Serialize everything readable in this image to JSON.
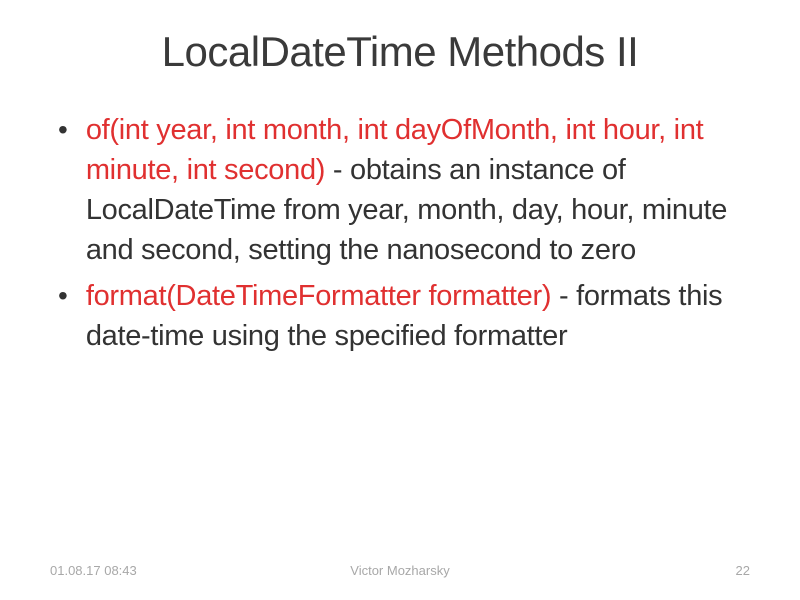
{
  "title": "LocalDateTime Methods II",
  "bullets": [
    {
      "red": "of(int year, int month, int dayOfMonth,  int hour, int minute, int second)",
      "black": " - obtains an instance of LocalDateTime from year, month, day, hour, minute and second, setting the nanosecond to zero"
    },
    {
      "red": "format(DateTimeFormatter  formatter)",
      "black": " - formats this date-time using the specified formatter"
    }
  ],
  "footer": {
    "date": "01.08.17 08:43",
    "author": "Victor Mozharsky",
    "page": "22"
  }
}
